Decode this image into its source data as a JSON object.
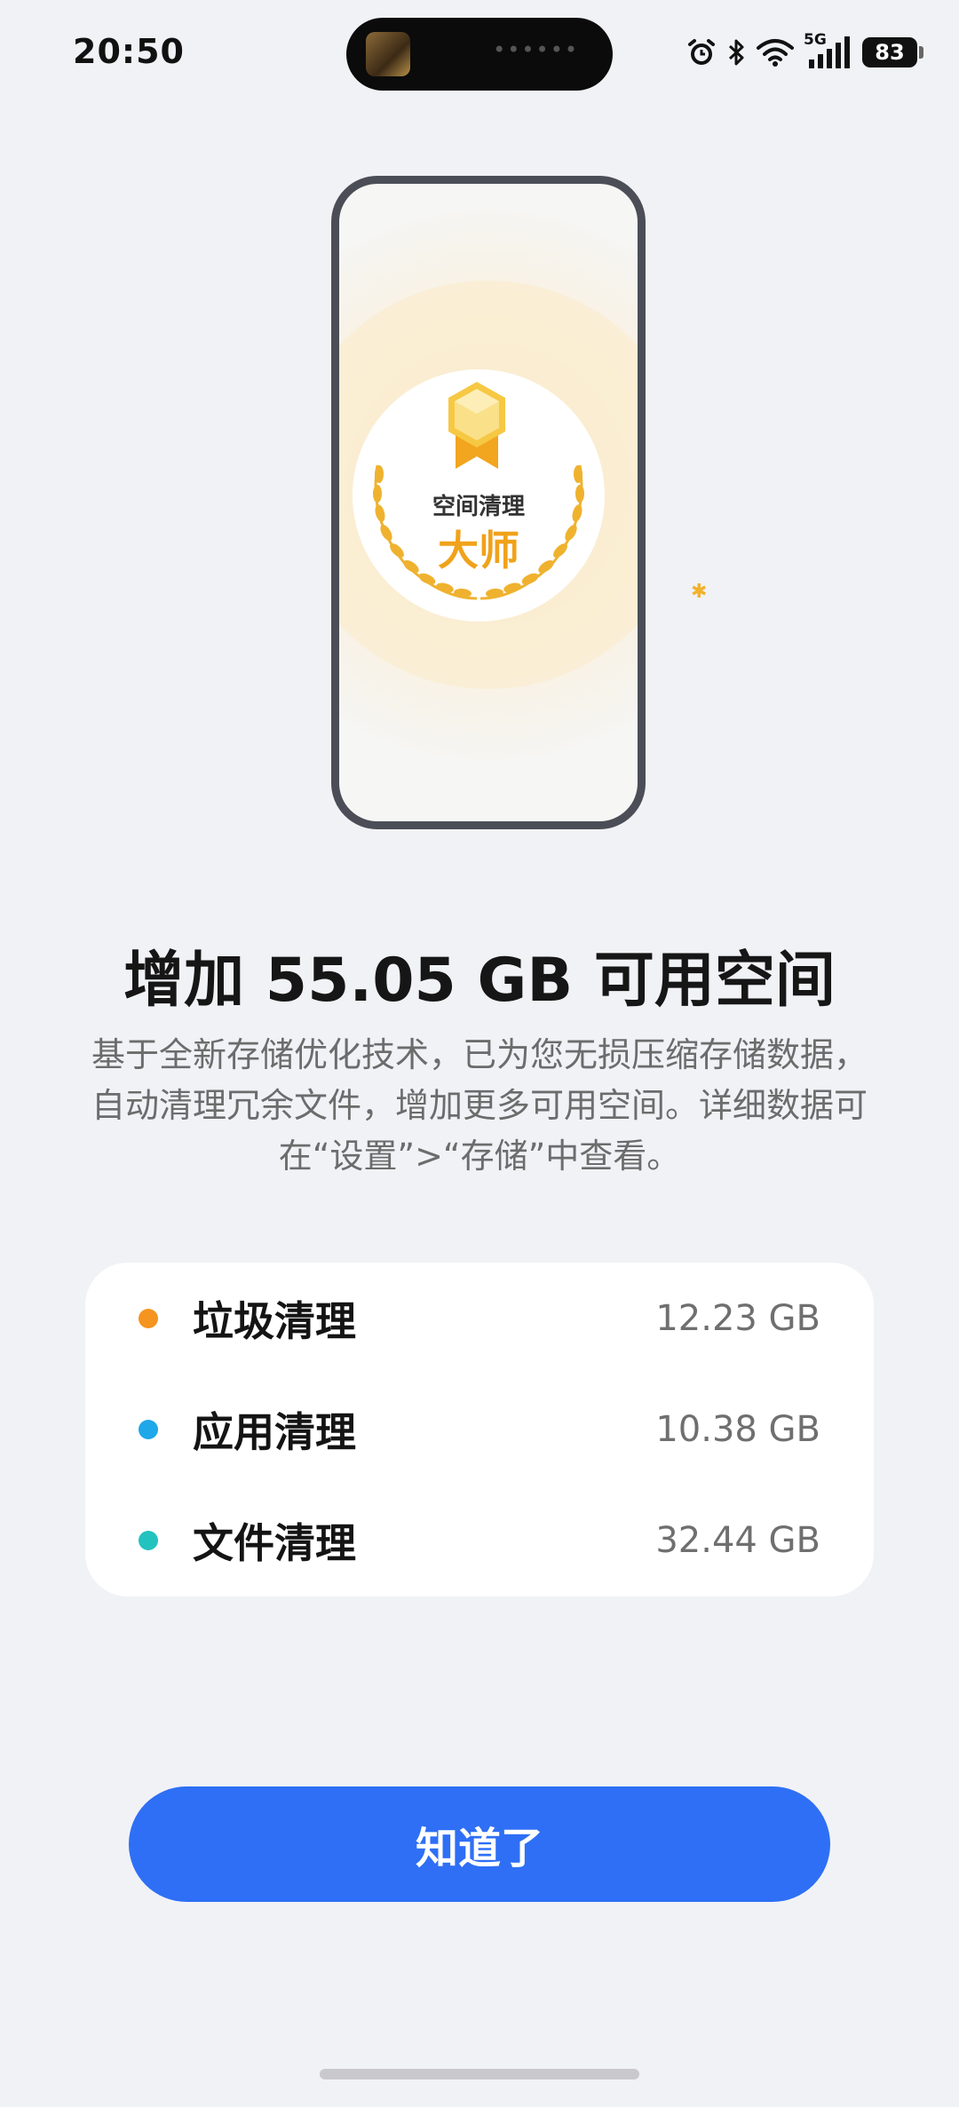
{
  "status_bar": {
    "time": "20:50",
    "network": "5G",
    "battery": "83",
    "icons": [
      "alarm-icon",
      "bluetooth-icon",
      "wifi-icon",
      "signal-icon",
      "battery-icon"
    ]
  },
  "badge": {
    "line1": "空间清理",
    "line2": "大师"
  },
  "headline": "增加 55.05 GB 可用空间",
  "description": "基于全新存储优化技术，已为您无损压缩存储数据，自动清理冗余文件，增加更多可用空间。详细数据可在“设置”>“存储”中查看。",
  "items": [
    {
      "label": "垃圾清理",
      "value": "12.23 GB",
      "color": "#f5941e"
    },
    {
      "label": "应用清理",
      "value": "10.38 GB",
      "color": "#1ea7e9"
    },
    {
      "label": "文件清理",
      "value": "32.44 GB",
      "color": "#22c3bf"
    }
  ],
  "button": {
    "label": "知道了"
  },
  "colors": {
    "accent": "#2e6ff5",
    "badge_gold": "#f0a21a",
    "background": "#f1f2f6"
  }
}
